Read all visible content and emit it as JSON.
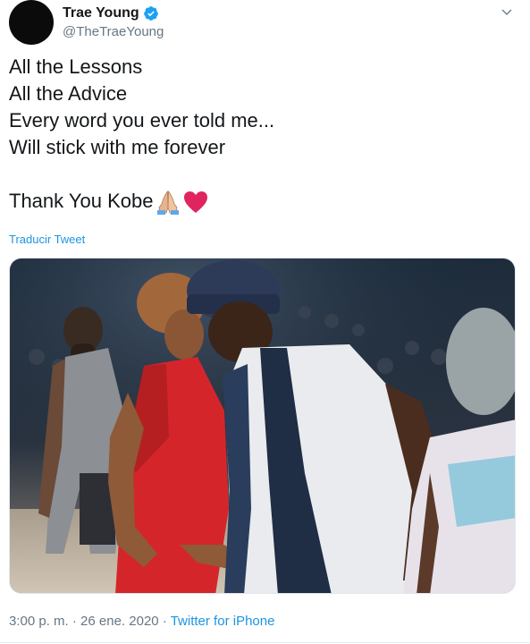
{
  "author": {
    "display_name": "Trae Young",
    "handle": "@TheTraeYoung",
    "verified": true,
    "icons": {
      "verified": "verified-badge-icon",
      "more": "chevron-down-icon"
    }
  },
  "tweet": {
    "lines": [
      "All the Lessons",
      "All the Advice",
      "Every word you ever told me...",
      "Will stick with me forever"
    ],
    "closing": "Thank You Kobe",
    "emojis": [
      "praying-hands-icon",
      "red-heart-icon"
    ]
  },
  "translate_label": "Traducir Tweet",
  "media": {
    "type": "photo"
  },
  "meta": {
    "time": "3:00 p. m.",
    "separator": "·",
    "date": "26 ene. 2020",
    "source": "Twitter for iPhone"
  },
  "colors": {
    "link": "#1b95e0",
    "secondary_text": "#657786",
    "primary_text": "#14171a",
    "verified": "#1da1f2",
    "heart": "#e0245e"
  }
}
